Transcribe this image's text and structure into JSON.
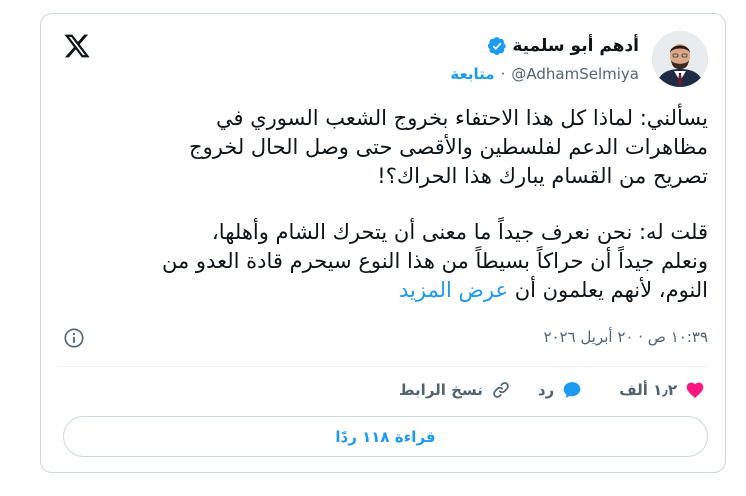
{
  "author": {
    "name": "أدهم أبو سلمية",
    "handle": "@AdhamSelmiya",
    "follow_label": "متابعة",
    "separator": "·",
    "verified": true
  },
  "tweet": {
    "lines_para1": [
      "يسألني: لماذا كل هذا الاحتفاء بخروج الشعب السوري في",
      "مظاهرات الدعم لفلسطين والأقصى حتى وصل الحال لخروج",
      "تصريح من القسام يبارك هذا الحراك؟!"
    ],
    "lines_para2": [
      "قلت له: نحن نعرف جيداً ما معنى أن يتحرك الشام وأهلها،",
      "ونعلم جيداً أن حراكاً بسيطاً من هذا النوع سيحرم قادة العدو من",
      "النوم، لأنهم يعلمون أن"
    ],
    "show_more": "عرض المزيد",
    "timestamp": "١٠:٣٩ ص · ٢٠ أبريل ٢٠٢٦"
  },
  "actions": {
    "likes_count": "١٫٢ ألف",
    "reply_label": "رد",
    "copy_link_label": "نسخ الرابط"
  },
  "read_replies_label": "قراءة ١١٨ ردًا",
  "colors": {
    "accent": "#1d9bf0",
    "like": "#f91880",
    "muted": "#536471",
    "text": "#0f1419"
  },
  "icons": [
    "verified-badge-icon",
    "x-logo-icon",
    "info-icon",
    "heart-icon",
    "reply-bubble-icon",
    "link-icon"
  ]
}
